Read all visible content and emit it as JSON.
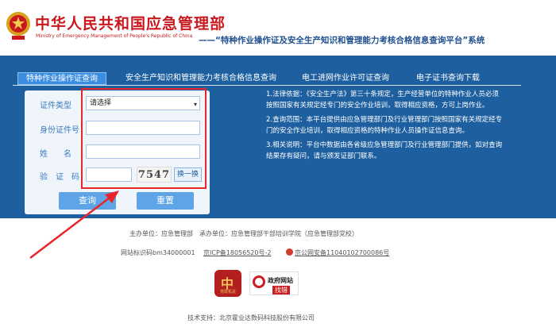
{
  "header": {
    "org_name_cn": "中华人民共和国应急管理部",
    "org_name_en": "Ministry of Emergency Management of People's Republic of China",
    "system_title": "——“特种作业操作证及安全生产知识和管理能力考核合格信息查询平台”系统"
  },
  "tabs": [
    {
      "label": "特种作业操作证查询",
      "active": true
    },
    {
      "label": "安全生产知识和管理能力考核合格信息查询",
      "active": false
    },
    {
      "label": "电工进网作业许可证查询",
      "active": false
    },
    {
      "label": "电子证书查询下载",
      "active": false
    }
  ],
  "form": {
    "cert_type_label": "证件类型",
    "cert_type_value": "请选择",
    "id_label": "身份证件号",
    "name_label": "姓　　名",
    "captcha_label": "验　证　码",
    "captcha_code": "7547",
    "refresh_label": "换一换",
    "query_label": "查询",
    "reset_label": "重置"
  },
  "info": [
    "1.法律依据：《安全生产法》第三十条规定，生产经营单位的特种作业人员必须按照国家有关规定经专门的安全作业培训，取得相应资格，方可上岗作业。",
    "2.查询范围：本平台提供由应急管理部门及行业管理部门按照国家有关规定经专门的安全作业培训，取得相应资格的特种作业人员操作证信息查询。",
    "3.相关说明：平台中数据由各省级应急管理部门及行业管理部门提供，如对查询结果存有疑问，请与颁发证部门联系。"
  ],
  "footer": {
    "sponsor": "主办单位：应急管理部　承办单位：应急管理部干部培训学院（应急管理部党校）",
    "site_id": "网站标识码bm34000001",
    "icp": "京ICP备18056520号-2",
    "police": "京公网安备11040102700086号",
    "badge_left_text": "党政机关",
    "gov_badge_title": "政府网站",
    "gov_badge_action": "找错",
    "support": "技术支持：北京霍业达数码科技股份有限公司"
  },
  "colors": {
    "brand_red": "#c9171e",
    "band_blue": "#1d5f9f",
    "highlight": "#e8262a"
  }
}
